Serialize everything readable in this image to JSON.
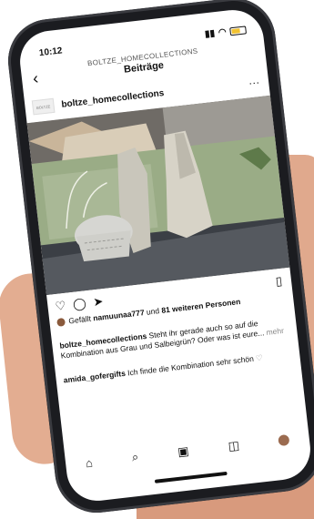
{
  "status": {
    "time": "10:12"
  },
  "nav": {
    "username": "BOLTZE_HOMECOLLECTIONS",
    "title": "Beiträge"
  },
  "post": {
    "avatar_text": "BOLTZE",
    "username": "boltze_homecollections",
    "liked_prefix": "Gefällt ",
    "liked_user": "namuunaa777",
    "liked_mid": " und ",
    "liked_count": "81 weiteren Personen",
    "caption_user": "boltze_homecollections",
    "caption_text": " Steht ihr gerade auch so auf die Kombination aus Grau und Salbeigrün? Oder was ist eure...",
    "caption_more": " mehr",
    "comment_user": "amida_gofergifts",
    "comment_text": " Ich finde die Kombination sehr schön"
  },
  "icons": {
    "back": "back-icon",
    "more": "more-icon",
    "like": "heart-icon",
    "comment": "comment-icon",
    "share": "send-icon",
    "save": "bookmark-icon",
    "home": "home-icon",
    "search": "search-icon",
    "reels": "reels-icon",
    "shop": "shop-icon"
  },
  "colors": {
    "pillow_green": "#9aac86",
    "vase": "#c9c6bb",
    "candle_holder": "#d6d6d2"
  }
}
